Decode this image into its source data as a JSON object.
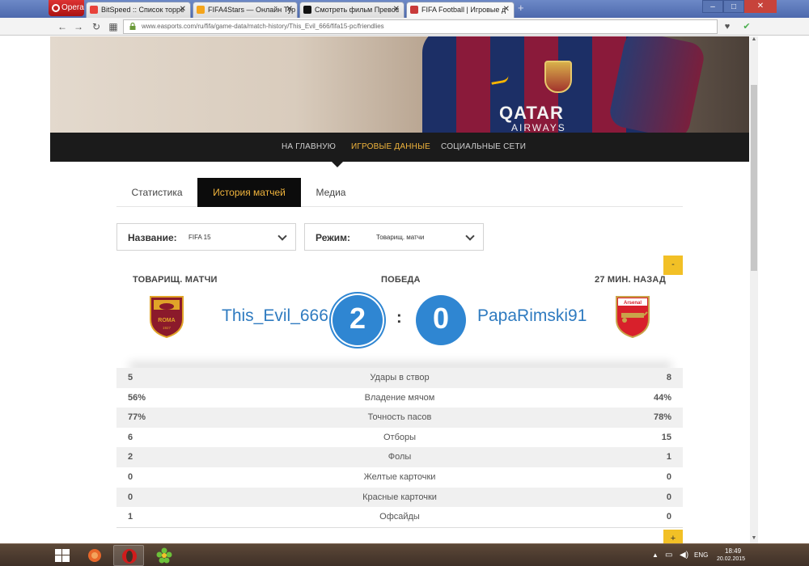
{
  "browser": {
    "menu_label": "Opera",
    "tabs": [
      {
        "label": "BitSpeed :: Список торре",
        "favicon_color": "#e8423a"
      },
      {
        "label": "FIFA4Stars — Онлайн Тур",
        "favicon_color": "#f4a51c"
      },
      {
        "label": "Смотреть фильм Превос",
        "favicon_color": "#111111"
      },
      {
        "label": "FIFA Football | Игровые д",
        "favicon_color": "#c83a3a"
      }
    ],
    "new_tab_label": "+",
    "url": "www.easports.com/ru/fifa/game-data/match-history/This_Evil_666/fifa15-pc/friendlies",
    "window_controls": {
      "minimize": "–",
      "maximize": "□",
      "close": "✕"
    }
  },
  "hero": {
    "sponsor_line1": "QATAR",
    "sponsor_line2": "AIRWAYS"
  },
  "main_nav": {
    "items": [
      {
        "label": "НА ГЛАВНУЮ"
      },
      {
        "label": "ИГРОВЫЕ ДАННЫЕ"
      },
      {
        "label": "СОЦИАЛЬНЫЕ СЕТИ"
      }
    ],
    "active_index": 1
  },
  "sub_tabs": {
    "items": [
      {
        "label": "Статистика"
      },
      {
        "label": "История матчей"
      },
      {
        "label": "Медиа"
      }
    ],
    "active_index": 1
  },
  "filters": {
    "name_label": "Название:",
    "name_value": "FIFA 15",
    "mode_label": "Режим:",
    "mode_value": "Товарищ. матчи"
  },
  "match": {
    "mode": "ТОВАРИЩ. МАТЧИ",
    "result": "ПОБЕДА",
    "time_ago": "27 МИН. НАЗАД",
    "home_player": "This_Evil_666",
    "away_player": "PapaRimski91",
    "home_score": "2",
    "away_score": "0",
    "separator": ":",
    "home_crest_text": "ROMA",
    "home_crest_year": "1927",
    "away_crest_text": "Arsenal",
    "collapse_label": "-",
    "expand_label": "+"
  },
  "stats": [
    {
      "home": "5",
      "label": "Удары в створ",
      "away": "8"
    },
    {
      "home": "56%",
      "label": "Владение мячом",
      "away": "44%"
    },
    {
      "home": "77%",
      "label": "Точность пасов",
      "away": "78%"
    },
    {
      "home": "6",
      "label": "Отборы",
      "away": "15"
    },
    {
      "home": "2",
      "label": "Фолы",
      "away": "1"
    },
    {
      "home": "0",
      "label": "Желтые карточки",
      "away": "0"
    },
    {
      "home": "0",
      "label": "Красные карточки",
      "away": "0"
    },
    {
      "home": "1",
      "label": "Офсайды",
      "away": "0"
    }
  ],
  "taskbar": {
    "language": "ENG",
    "time": "18:49",
    "date": "20.02.2015"
  }
}
